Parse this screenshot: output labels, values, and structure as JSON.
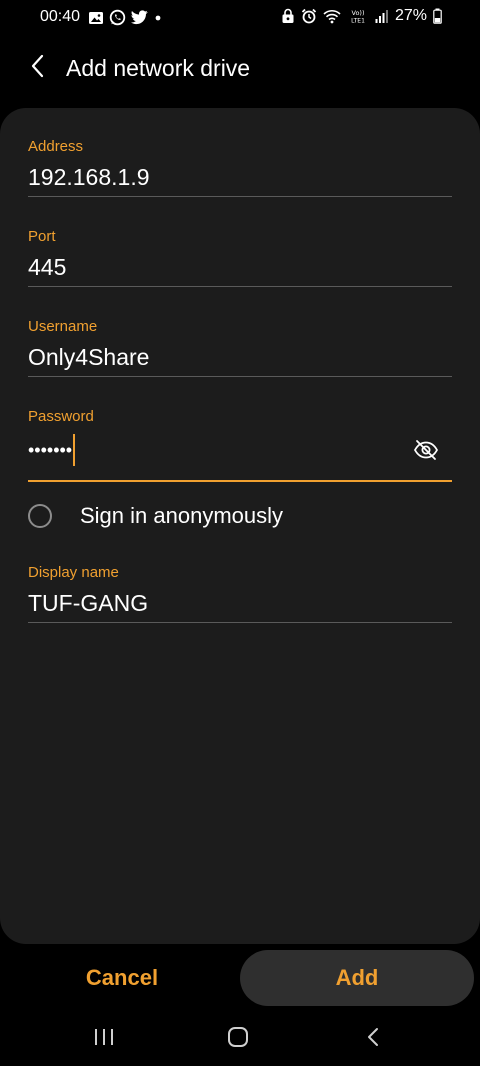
{
  "status_bar": {
    "time": "00:40",
    "battery": "27%",
    "left_icons": [
      "gallery-icon",
      "whatsapp-icon",
      "twitter-icon",
      "notification-dot-icon"
    ],
    "right_icons": [
      "lock-icon",
      "alarm-icon",
      "wifi-icon",
      "volte-icon",
      "signal-icon",
      "battery-icon"
    ]
  },
  "header": {
    "title": "Add network drive",
    "back_icon": "chevron-left-icon"
  },
  "form": {
    "address": {
      "label": "Address",
      "value": "192.168.1.9"
    },
    "port": {
      "label": "Port",
      "value": "445"
    },
    "username": {
      "label": "Username",
      "value": "Only4Share"
    },
    "password": {
      "label": "Password",
      "value": "•••••••",
      "toggle_icon": "eye-off-icon"
    },
    "anonymous": {
      "label": "Sign in anonymously",
      "checked": false
    },
    "display_name": {
      "label": "Display name",
      "value": "TUF-GANG"
    }
  },
  "actions": {
    "cancel_label": "Cancel",
    "add_label": "Add"
  },
  "nav_bar": {
    "buttons": [
      "recents-icon",
      "home-icon",
      "back-icon"
    ]
  },
  "colors": {
    "accent": "#f0a030",
    "background": "#000000",
    "card": "#1c1c1c",
    "divider": "#5a5a5a",
    "add_button_bg": "#2f2f2f"
  }
}
